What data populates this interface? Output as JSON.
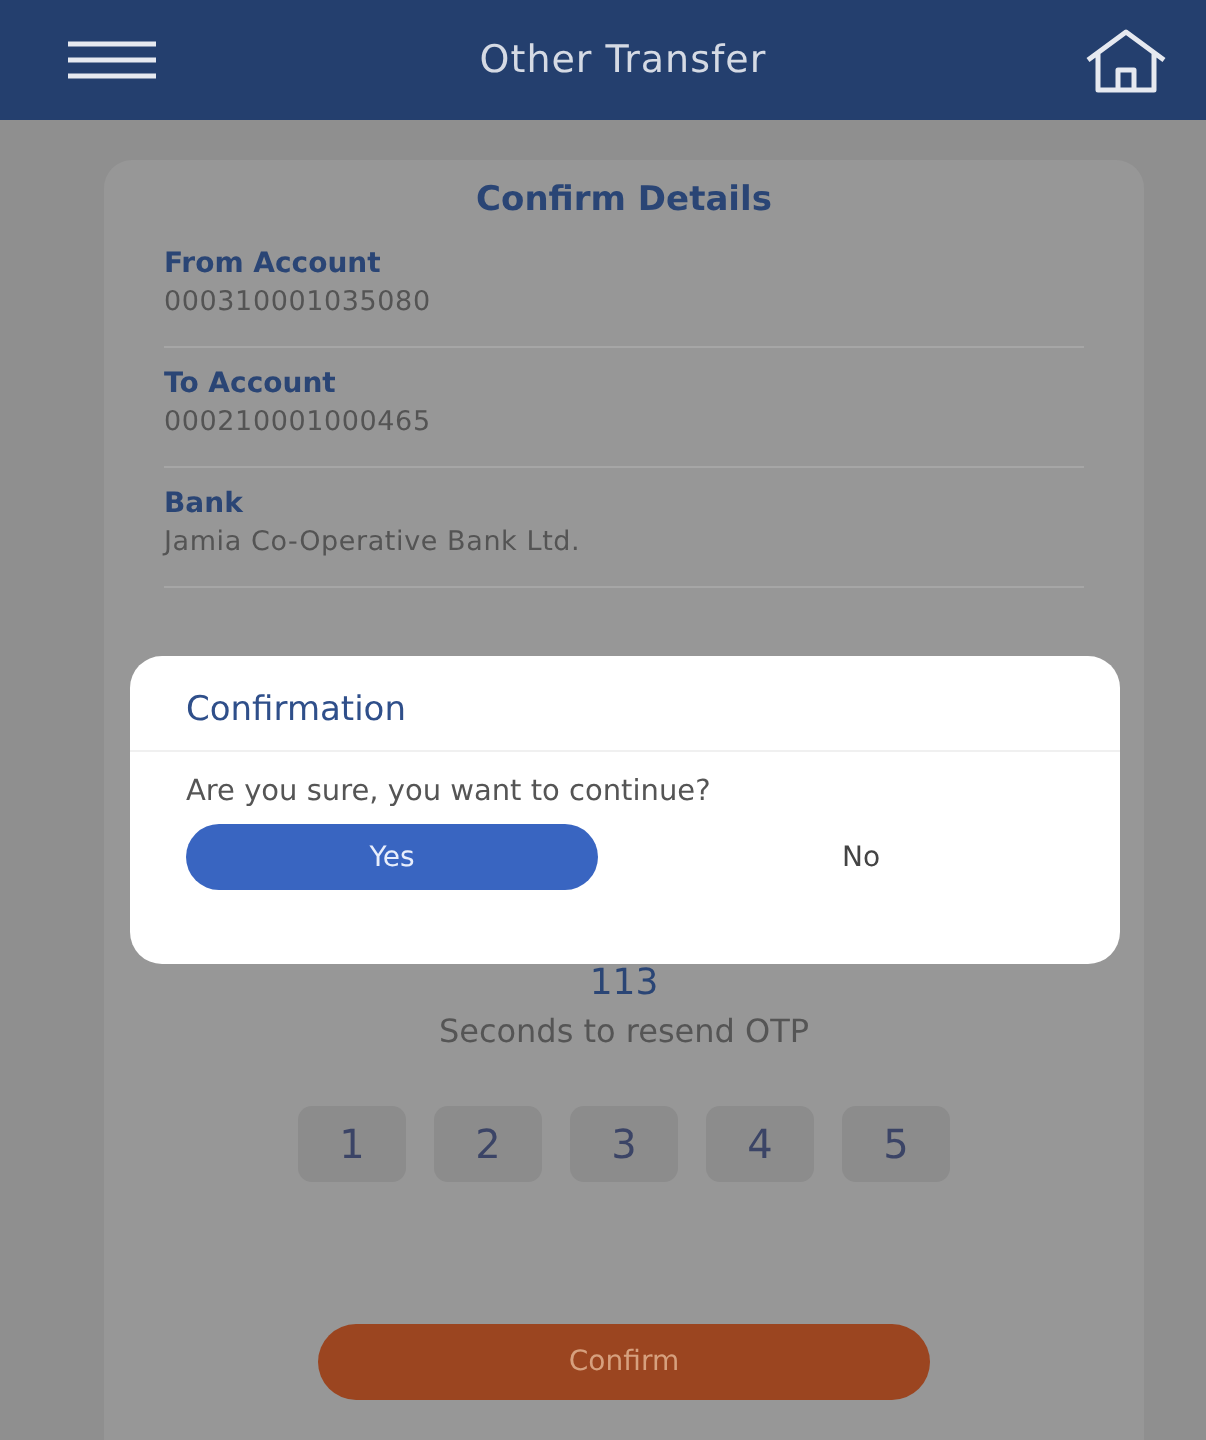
{
  "header": {
    "title": "Other Transfer"
  },
  "card": {
    "title": "Confirm Details",
    "details": [
      {
        "label": "From Account",
        "value": "000310001035080"
      },
      {
        "label": "To Account",
        "value": "000210001000465"
      },
      {
        "label": "Bank",
        "value": "Jamia Co-Operative Bank Ltd."
      }
    ],
    "timer": "113",
    "timer_text": "Seconds to resend OTP",
    "otp_digits": [
      "1",
      "2",
      "3",
      "4",
      "5"
    ],
    "confirm_button": "Confirm"
  },
  "dialog": {
    "title": "Confirmation",
    "message": "Are you sure, you want to continue?",
    "buttons": [
      {
        "label": "Yes",
        "kind": "primary"
      },
      {
        "label": "No",
        "kind": "plain"
      }
    ]
  }
}
